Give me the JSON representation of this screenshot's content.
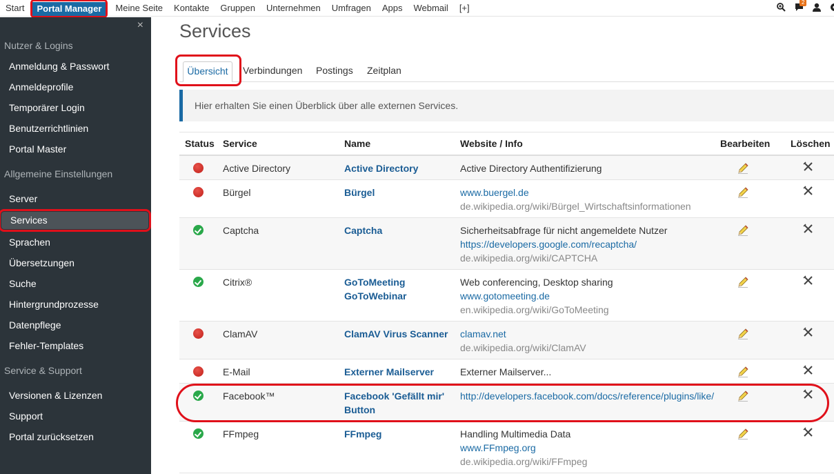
{
  "topnav": {
    "items": [
      "Start",
      "Portal Manager",
      "Meine Seite",
      "Kontakte",
      "Gruppen",
      "Unternehmen",
      "Umfragen",
      "Apps",
      "Webmail",
      "[+]"
    ],
    "badge_count": "2"
  },
  "sidebar": {
    "close": "×",
    "section1": "Nutzer & Logins",
    "items1": [
      "Anmeldung & Passwort",
      "Anmeldeprofile",
      "Temporärer Login",
      "Benutzerrichtlinien",
      "Portal Master"
    ],
    "section2": "Allgemeine Einstellungen",
    "items2": [
      "Server",
      "Services",
      "Sprachen",
      "Übersetzungen",
      "Suche",
      "Hintergrundprozesse",
      "Datenpflege",
      "Fehler-Templates"
    ],
    "section3": "Service & Support",
    "items3": [
      "Versionen & Lizenzen",
      "Support",
      "Portal zurücksetzen"
    ]
  },
  "main": {
    "title": "Services",
    "tabs": [
      "Übersicht",
      "Verbindungen",
      "Postings",
      "Zeitplan"
    ],
    "info": "Hier erhalten Sie einen Überblick über alle externen Services.",
    "columns": {
      "status": "Status",
      "service": "Service",
      "name": "Name",
      "website": "Website / Info",
      "edit": "Bearbeiten",
      "delete": "Löschen"
    },
    "rows": [
      {
        "status": "red",
        "service": "Active Directory",
        "name": [
          "Active Directory"
        ],
        "info": [
          {
            "t": "plain",
            "v": "Active Directory Authentifizierung"
          }
        ]
      },
      {
        "status": "red",
        "service": "Bürgel",
        "name": [
          "Bürgel"
        ],
        "info": [
          {
            "t": "link",
            "v": "www.buergel.de"
          },
          {
            "t": "grey",
            "v": "de.wikipedia.org/wiki/Bürgel_Wirtschaftsinformationen"
          }
        ]
      },
      {
        "status": "green",
        "service": "Captcha",
        "name": [
          "Captcha"
        ],
        "info": [
          {
            "t": "plain",
            "v": "Sicherheitsabfrage für nicht angemeldete Nutzer"
          },
          {
            "t": "link",
            "v": "https://developers.google.com/recaptcha/"
          },
          {
            "t": "grey",
            "v": "de.wikipedia.org/wiki/CAPTCHA"
          }
        ]
      },
      {
        "status": "green",
        "service": "Citrix®",
        "name": [
          "GoToMeeting",
          "GoToWebinar"
        ],
        "info": [
          {
            "t": "plain",
            "v": "Web conferencing, Desktop sharing"
          },
          {
            "t": "link",
            "v": "www.gotomeeting.de"
          },
          {
            "t": "grey",
            "v": "en.wikipedia.org/wiki/GoToMeeting"
          }
        ]
      },
      {
        "status": "red",
        "service": "ClamAV",
        "name": [
          "ClamAV Virus Scanner"
        ],
        "info": [
          {
            "t": "link",
            "v": "clamav.net"
          },
          {
            "t": "grey",
            "v": "de.wikipedia.org/wiki/ClamAV"
          }
        ]
      },
      {
        "status": "red",
        "service": "E-Mail",
        "name": [
          "Externer Mailserver"
        ],
        "info": [
          {
            "t": "plain",
            "v": "Externer Mailserver..."
          }
        ]
      },
      {
        "status": "green",
        "service": "Facebook™",
        "name": [
          "Facebook 'Gefällt mir'",
          "Button"
        ],
        "info": [
          {
            "t": "link",
            "v": "http://developers.facebook.com/docs/reference/plugins/like/"
          }
        ]
      },
      {
        "status": "green",
        "service": "FFmpeg",
        "name": [
          "FFmpeg"
        ],
        "info": [
          {
            "t": "plain",
            "v": "Handling Multimedia Data"
          },
          {
            "t": "link",
            "v": "www.FFmpeg.org"
          },
          {
            "t": "grey",
            "v": "de.wikipedia.org/wiki/FFmpeg"
          }
        ]
      }
    ]
  }
}
